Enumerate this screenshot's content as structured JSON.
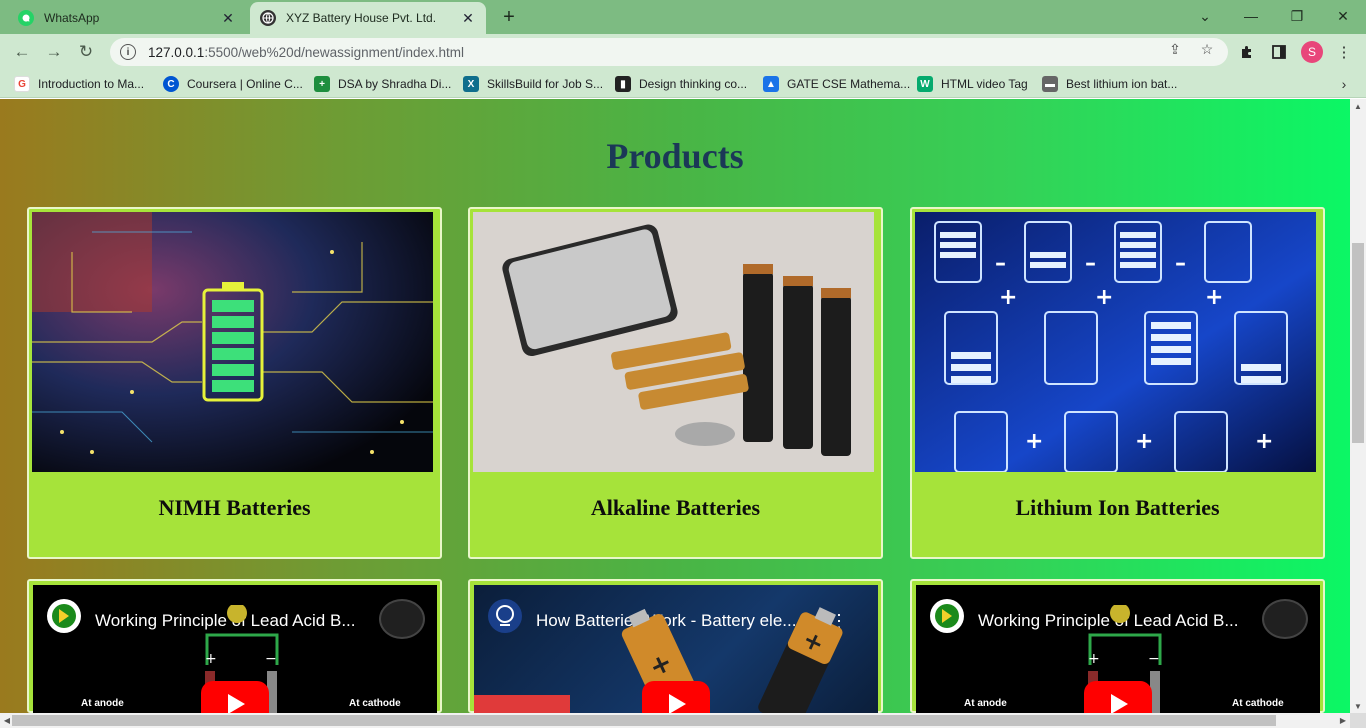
{
  "tabs": [
    {
      "title": "WhatsApp",
      "icon": "whatsapp-icon",
      "active": false
    },
    {
      "title": "XYZ Battery House Pvt. Ltd.",
      "icon": "globe-icon",
      "active": true
    }
  ],
  "address_bar": {
    "url_host": "127.0.0.1",
    "url_path": ":5500/web%20d/newassignment/index.html"
  },
  "profile_initial": "S",
  "bookmarks": [
    {
      "label": "Introduction to Ma...",
      "icon": "google-icon",
      "color": "#ea4335"
    },
    {
      "label": "Coursera | Online C...",
      "icon": "coursera-icon",
      "color": "#0056d2"
    },
    {
      "label": "DSA by Shradha Di...",
      "icon": "bookmark-plus-icon",
      "color": "#1e8e3e"
    },
    {
      "label": "SkillsBuild for Job S...",
      "icon": "skillsbuild-icon",
      "color": "#0f6e8c"
    },
    {
      "label": "Design thinking co...",
      "icon": "design-icon",
      "color": "#222222"
    },
    {
      "label": "GATE CSE Mathema...",
      "icon": "graduation-cap-icon",
      "color": "#1a73e8"
    },
    {
      "label": "HTML video Tag",
      "icon": "w3schools-icon",
      "color": "#04aa6d"
    },
    {
      "label": "Best lithium ion bat...",
      "icon": "battery-icon",
      "color": "#666666"
    }
  ],
  "page": {
    "heading": "Products",
    "products": [
      {
        "name": "NIMH Batteries",
        "image": "circuit-battery-image"
      },
      {
        "name": "Alkaline Batteries",
        "image": "assorted-batteries-image"
      },
      {
        "name": "Lithium Ion Batteries",
        "image": "blue-battery-icons-image"
      }
    ],
    "videos": [
      {
        "title": "Working Principle of Lead Acid B...",
        "caption_left": "At anode",
        "caption_right": "At cathode"
      },
      {
        "title": "How Batteries Work - Battery ele...",
        "caption_left": "",
        "caption_right": ""
      },
      {
        "title": "Working Principle of Lead Acid B...",
        "caption_left": "At anode",
        "caption_right": "At cathode"
      }
    ]
  },
  "colors": {
    "heading": "#1b3857",
    "card_bg": "#a6e33a",
    "youtube_red": "#ff0000"
  }
}
